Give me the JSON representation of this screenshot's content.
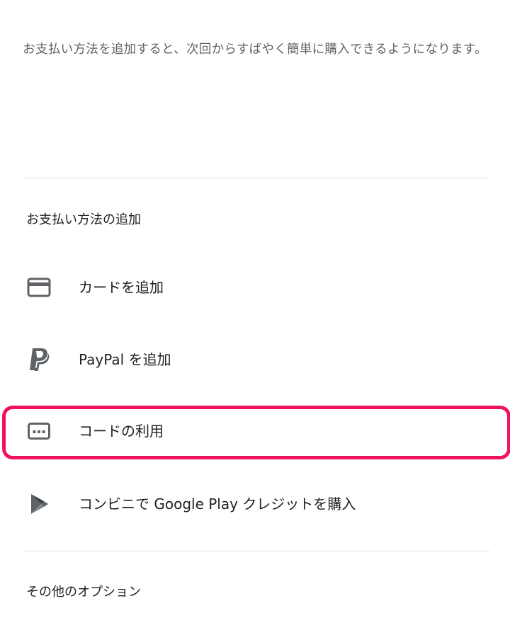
{
  "description": "お支払い方法を追加すると、次回からすばやく簡単に購入できるようになります。",
  "add_section": {
    "title": "お支払い方法の追加",
    "options": [
      {
        "label": "カードを追加",
        "icon": "credit-card-icon"
      },
      {
        "label": "PayPal を追加",
        "icon": "paypal-icon"
      },
      {
        "label": "コードの利用",
        "icon": "redeem-code-icon"
      },
      {
        "label": "コンビニで Google Play クレジットを購入",
        "icon": "google-play-icon"
      }
    ]
  },
  "other_section": {
    "title": "その他のオプション"
  },
  "colors": {
    "icon": "#5f6368",
    "highlight": "#f0145a",
    "divider": "#dadce0"
  }
}
